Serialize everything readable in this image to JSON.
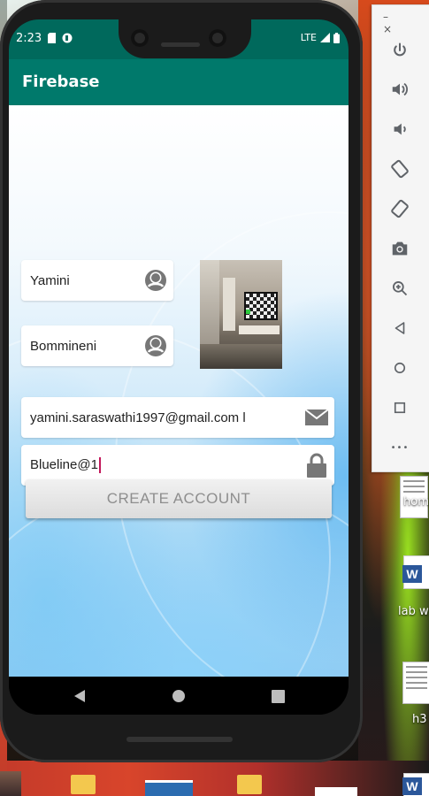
{
  "status_bar": {
    "time": "2:23",
    "network": "LTE"
  },
  "app_bar": {
    "title": "Firebase"
  },
  "form": {
    "first_name": "Yamini",
    "last_name": "Bommineni",
    "email": "yamini.saraswathi1997@gmail.com l",
    "password": "Blueline@1",
    "create_button_label": "CREATE ACCOUNT"
  },
  "icons": {
    "first_name": "person-icon",
    "last_name": "person-icon",
    "email": "envelope-icon",
    "password": "lock-icon"
  },
  "emulator_toolbar": {
    "minimize": "–",
    "close": "×",
    "more": "•••",
    "buttons": [
      "power-icon",
      "volume-up-icon",
      "volume-down-icon",
      "rotate-left-icon",
      "rotate-right-icon",
      "camera-icon",
      "zoom-icon",
      "back-icon",
      "home-icon",
      "overview-icon",
      "more-icon"
    ]
  },
  "desktop": {
    "icon_labels": [
      "hom",
      "lab w",
      "h3"
    ]
  },
  "colors": {
    "status_bar": "#00695c",
    "app_bar": "#00796b",
    "cursor": "#c2185b"
  }
}
